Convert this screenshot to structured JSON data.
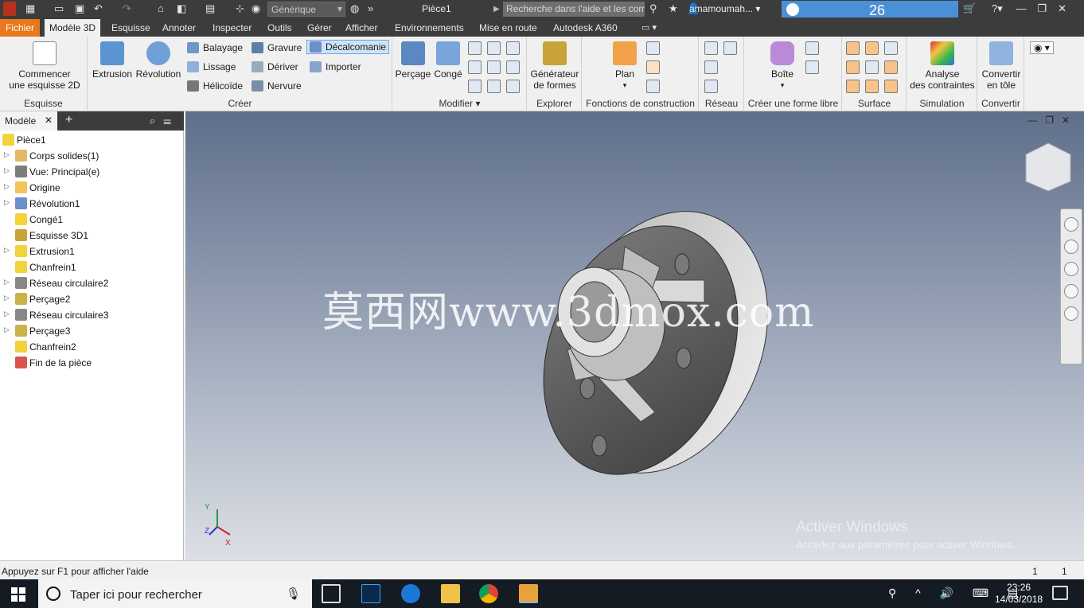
{
  "titlebar": {
    "appearance": "Générique",
    "document_title": "Pièce1",
    "help_search_placeholder": "Recherche dans l'aide et les com",
    "user": "amamoumah...",
    "trial_days": "26",
    "window_buttons": "—❐✕"
  },
  "tabs": [
    {
      "label": "Fichier"
    },
    {
      "label": "Modèle 3D"
    },
    {
      "label": "Esquisse"
    },
    {
      "label": "Annoter"
    },
    {
      "label": "Inspecter"
    },
    {
      "label": "Outils"
    },
    {
      "label": "Gérer"
    },
    {
      "label": "Afficher"
    },
    {
      "label": "Environnements"
    },
    {
      "label": "Mise en route"
    },
    {
      "label": "Autodesk A360"
    }
  ],
  "ribbon": {
    "esquisse": {
      "label": "Esquisse",
      "start_sketch_line1": "Commencer",
      "start_sketch_line2": "une esquisse 2D"
    },
    "creer": {
      "label": "Créer",
      "extrusion": "Extrusion",
      "revolution": "Révolution",
      "balayage": "Balayage",
      "lissage": "Lissage",
      "helicoide": "Hélicoïde",
      "gravure": "Gravure",
      "deriver": "Dériver",
      "nervure": "Nervure",
      "decalcomanie": "Décalcomanie",
      "importer": "Importer"
    },
    "modifier": {
      "label": "Modifier",
      "percage": "Perçage",
      "conge": "Congé"
    },
    "explorer": {
      "label": "Explorer",
      "gen_line1": "Générateur",
      "gen_line2": "de formes"
    },
    "construction": {
      "label": "Fonctions de construction",
      "plan": "Plan"
    },
    "reseau": {
      "label": "Réseau"
    },
    "forme_libre": {
      "label": "Créer une forme libre",
      "boite": "Boîte"
    },
    "surface": {
      "label": "Surface"
    },
    "simulation": {
      "label": "Simulation",
      "line1": "Analyse",
      "line2": "des contraintes"
    },
    "convertir": {
      "label": "Convertir",
      "line1": "Convertir",
      "line2": "en tôle"
    }
  },
  "browser": {
    "tab": "Modèle",
    "nodes": [
      {
        "label": "Pièce1",
        "color": "#f2d33c"
      },
      {
        "label": "Corps solides(1)",
        "color": "#e3b866"
      },
      {
        "label": "Vue: Principal(e)",
        "color": "#7d7d7d"
      },
      {
        "label": "Origine",
        "color": "#f3c45a"
      },
      {
        "label": "Révolution1",
        "color": "#6b8fc7"
      },
      {
        "label": "Congé1",
        "color": "#f2d33c"
      },
      {
        "label": "Esquisse 3D1",
        "color": "#c9a23a"
      },
      {
        "label": "Extrusion1",
        "color": "#f2d33c"
      },
      {
        "label": "Chanfrein1",
        "color": "#f2d33c"
      },
      {
        "label": "Réseau circulaire2",
        "color": "#888888"
      },
      {
        "label": "Perçage2",
        "color": "#c9b24a"
      },
      {
        "label": "Réseau circulaire3",
        "color": "#888888"
      },
      {
        "label": "Perçage3",
        "color": "#c9b24a"
      },
      {
        "label": "Chanfrein2",
        "color": "#f2d33c"
      },
      {
        "label": "Fin de la pièce",
        "color": "#d9534f"
      }
    ]
  },
  "viewport": {
    "watermark": "莫西网www.3dmox.com",
    "activate_title": "Activer Windows",
    "activate_sub": "Accédez aux paramètres pour activer Windows.",
    "axis_x": "X",
    "axis_y": "Y",
    "axis_z": "Z"
  },
  "status": {
    "text": "Appuyez sur F1 pour afficher l'aide",
    "count1": "1",
    "count2": "1"
  },
  "taskbar": {
    "search_placeholder": "Taper ici pour rechercher",
    "time": "23:26",
    "date": "14/03/2018"
  }
}
